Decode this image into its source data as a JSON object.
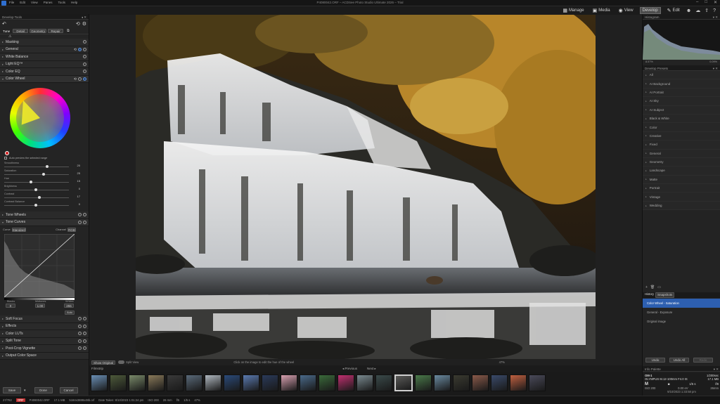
{
  "app": {
    "menus": [
      "File",
      "Edit",
      "View",
      "Panes",
      "Tools",
      "Help"
    ],
    "window_title": "P4080042.ORF – ACDSee Photo Studio Ultimate 2026 – Trial",
    "window_controls": [
      "–",
      "□",
      "✕"
    ]
  },
  "modes": [
    {
      "label": "Manage",
      "icon": "grid-icon"
    },
    {
      "label": "Media",
      "icon": "media-icon"
    },
    {
      "label": "View",
      "icon": "eye-icon"
    },
    {
      "label": "Develop",
      "icon": "develop-icon",
      "active": true
    },
    {
      "label": "Edit",
      "icon": "edit-icon"
    }
  ],
  "left": {
    "panel_title": "Develop Tools",
    "tabs": [
      "Tune",
      "Detail",
      "Geometry",
      "Repair"
    ],
    "sections_top": [
      "Masking",
      "General",
      "White Balance",
      "Light EQ™",
      "Color EQ",
      "Color Wheel"
    ],
    "colorwheel_note": "Auto preview the selected range",
    "sliders": [
      {
        "label": "Smoothness",
        "value": "20",
        "pos": 0.68
      },
      {
        "label": "Saturation",
        "value": "25",
        "pos": 0.62
      },
      {
        "label": "Hue",
        "value": "15",
        "pos": 0.42
      },
      {
        "label": "Brightness",
        "value": "0",
        "pos": 0.5
      },
      {
        "label": "Contrast",
        "value": "17",
        "pos": 0.55
      },
      {
        "label": "Contrast Balance",
        "value": "0",
        "pos": 0.5
      }
    ],
    "sections_mid": [
      "Tone Wheels",
      "Tone Curves"
    ],
    "curves": {
      "curve_label": "Curve",
      "curve_value": "Standard",
      "channel_label": "Channel",
      "channel_value": "RGB"
    },
    "levels": [
      {
        "label": "Blacks",
        "value": "0"
      },
      {
        "label": "Midtones",
        "value": "1.00"
      },
      {
        "label": "Whites",
        "value": "255"
      }
    ],
    "auto_label": "Auto",
    "sections_bottom": [
      "Soft Focus",
      "Effects",
      "Color LUTs",
      "Split Tone",
      "Post-Crop Vignette",
      "Output Color Space"
    ],
    "buttons": {
      "save": "Save",
      "done": "Done",
      "cancel": "Cancel"
    }
  },
  "image_toolbar": {
    "show_original": "Show Original",
    "split_view": "Split View",
    "hint": "Click on the image to edit the hue of the wheel",
    "previous": "Previous",
    "next": "Next",
    "zoom": "47%"
  },
  "right": {
    "histogram_title": "Histogram",
    "hist_left": "8.57%",
    "hist_right": "0.09%",
    "presets_title": "Develop Presets",
    "presets": [
      "All",
      "AI Background",
      "AI Portrait",
      "AI Sky",
      "AI Subject",
      "Black & White",
      "Color",
      "Creative",
      "Fixed",
      "General",
      "Geometry",
      "Landscape",
      "Matte",
      "Portrait",
      "Vintage",
      "Wedding"
    ],
    "history_tabs": [
      "History",
      "Snapshots"
    ],
    "history": [
      "Color Wheel - Saturation",
      "General - Exposure",
      "Original image"
    ],
    "undo": "Undo",
    "undo_all": "Undo All",
    "redo": "Redo",
    "info_title": "Info Palette",
    "camera": "OM-1",
    "lens": "OLYMPUS M.12-100mm F4.0 IS",
    "exposure": "1/5 s",
    "aperture": "f/8",
    "iso": "ISO 200",
    "ev": "0.00 eV",
    "focal": "26mm",
    "mode_label": "M",
    "shutter_full": "1/200sec",
    "size": "17.1 MB",
    "date": "9/10/2023 1:33:58 pm"
  },
  "film": {
    "title": "Filmstrip",
    "count": 24,
    "selected": 16
  },
  "status": {
    "index": "27/782",
    "format": "ORF",
    "file": "P4080042.ORF",
    "size": "17.1 MB",
    "dims": "5184x3888x48b.orf",
    "date": "Date Taken: 8/10/2023 1:01:24 pm",
    "iso": "ISO 200",
    "focal": "26 mm",
    "fstop": "f/5",
    "shutter": "1/5 s",
    "zoom": "47%"
  }
}
